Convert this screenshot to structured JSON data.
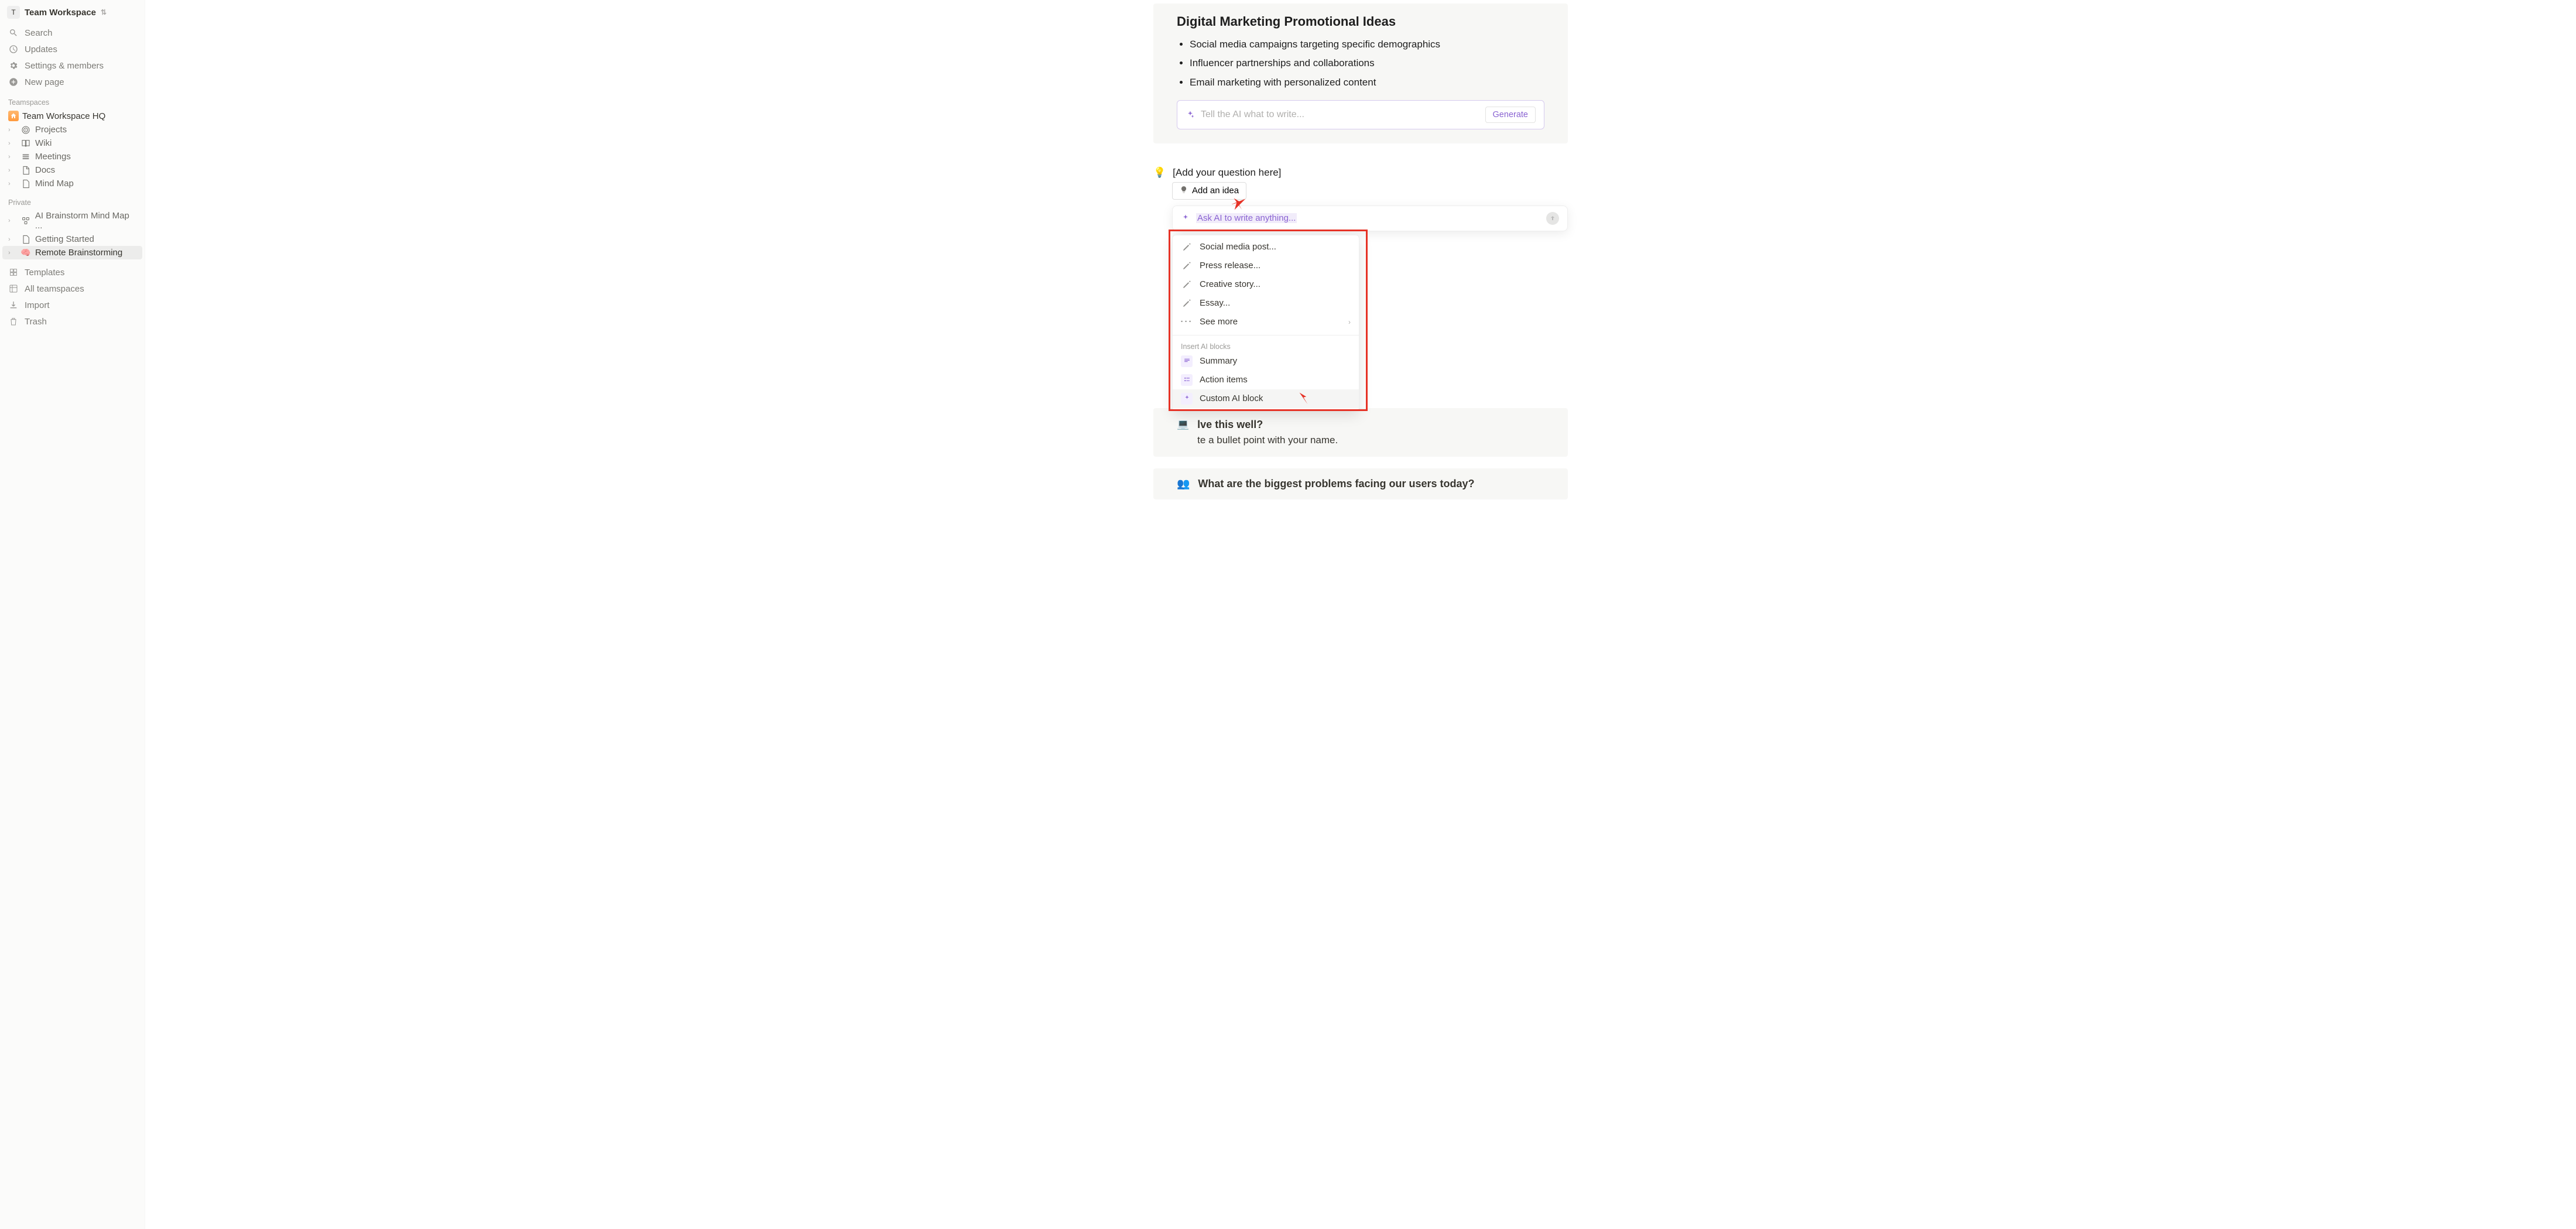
{
  "workspace": {
    "initial": "T",
    "name": "Team Workspace"
  },
  "sidebar": {
    "search": "Search",
    "updates": "Updates",
    "settings": "Settings & members",
    "newpage": "New page",
    "teamspaces_label": "Teamspaces",
    "hq": "Team Workspace HQ",
    "projects": "Projects",
    "wiki": "Wiki",
    "meetings": "Meetings",
    "docs": "Docs",
    "mindmap": "Mind Map",
    "private_label": "Private",
    "ai_brainstorm": "AI Brainstorm Mind Map ...",
    "getting_started": "Getting Started",
    "remote_brainstorm": "Remote Brainstorming",
    "templates": "Templates",
    "all_teamspaces": "All teamspaces",
    "import": "Import",
    "trash": "Trash"
  },
  "card1": {
    "title": "Digital Marketing Promotional Ideas",
    "bullets": [
      "Social media campaigns targeting specific demographics",
      "Influencer partnerships and collaborations",
      "Email marketing with personalized content"
    ],
    "ai_placeholder": "Tell the AI what to write...",
    "generate": "Generate"
  },
  "idea": {
    "emoji": "💡",
    "question": "[Add your question here]",
    "add_idea": "Add an idea",
    "ask_placeholder": "Ask AI to write anything..."
  },
  "dropdown": {
    "social": "Social media post...",
    "press": "Press release...",
    "story": "Creative story...",
    "essay": "Essay...",
    "see_more": "See more",
    "section": "Insert AI blocks",
    "summary": "Summary",
    "action_items": "Action items",
    "custom": "Custom AI block"
  },
  "peek": {
    "emoji": "💻",
    "head_suffix": "lve this well?",
    "body_suffix": "te a bullet point with your name.",
    "q2_emoji": "👥",
    "q2": "What are the biggest problems facing our users today?"
  }
}
